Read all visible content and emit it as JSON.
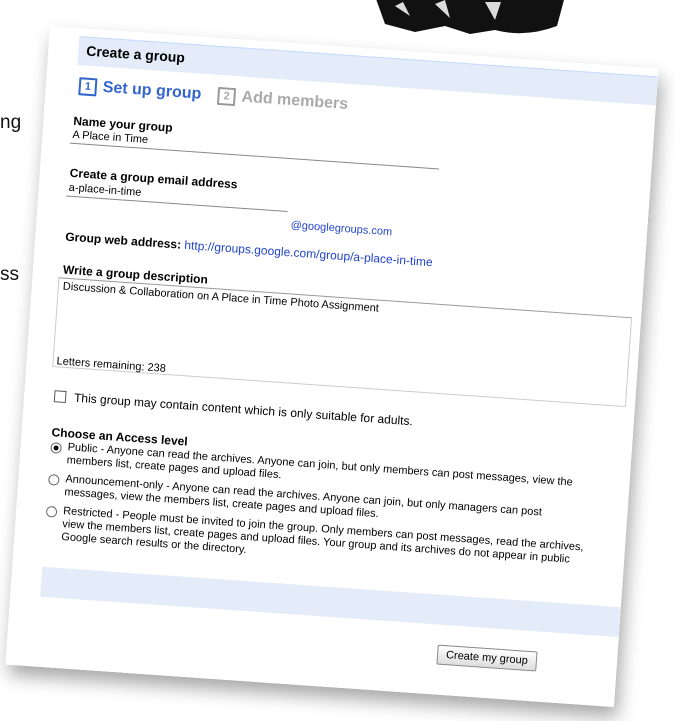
{
  "slide": {
    "fragment_1": "ng",
    "fragment_2": "ss"
  },
  "header": {
    "title": "Create a group"
  },
  "steps": [
    {
      "num": "1",
      "label": "Set up group"
    },
    {
      "num": "2",
      "label": "Add members"
    }
  ],
  "form": {
    "name_label": "Name your group",
    "name_value": "A Place in Time",
    "email_label": "Create a group email address",
    "email_value": "a-place-in-time",
    "email_domain": "@googlegroups.com",
    "web_address_label": "Group web address:",
    "web_address_value": "http://groups.google.com/group/a-place-in-time",
    "description_label": "Write a group description",
    "description_value": "Discussion & Collaboration on A Place in Time Photo Assignment",
    "letters_remaining": "Letters remaining: 238",
    "adult_content_label": "This group may contain content which is only suitable for adults.",
    "access_label": "Choose an Access level",
    "access_options": [
      {
        "label": "Public - Anyone can read the archives. Anyone can join, but only members can post messages, view the members list, create pages and upload files.",
        "checked": true
      },
      {
        "label": "Announcement-only - Anyone can read the archives. Anyone can join, but only managers can post messages, view the members list, create pages and upload files.",
        "checked": false
      },
      {
        "label": "Restricted - People must be invited to join the group. Only members can post messages, read the archives, view the members list, create pages and upload files. Your group and its archives do not appear in public Google search results or the directory.",
        "checked": false
      }
    ],
    "submit_label": "Create my group"
  }
}
